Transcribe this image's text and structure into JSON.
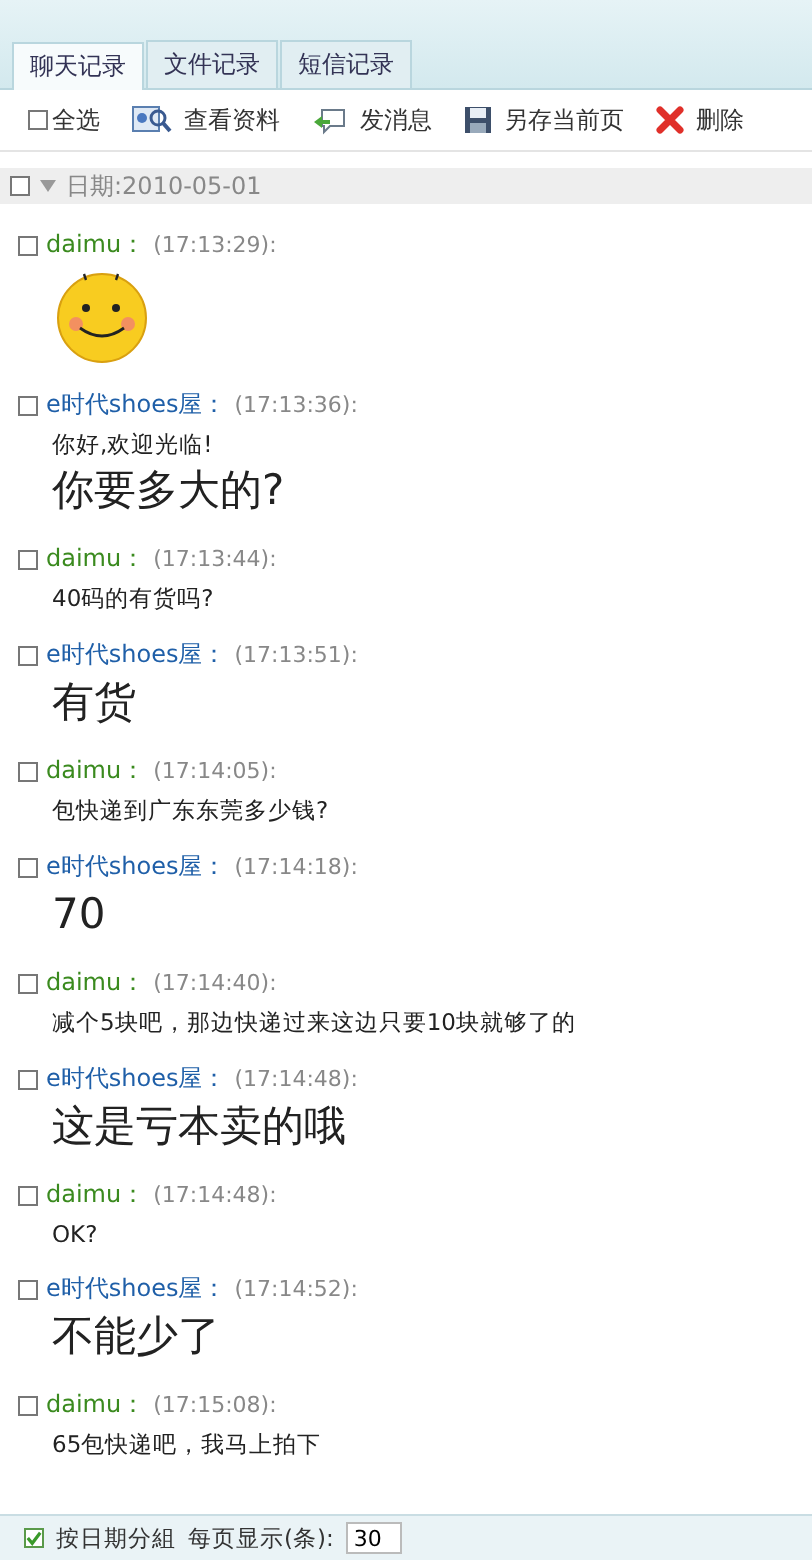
{
  "tabs": [
    {
      "label": "聊天记录",
      "selected": true
    },
    {
      "label": "文件记录",
      "selected": false
    },
    {
      "label": "短信记录",
      "selected": false
    }
  ],
  "toolbar": {
    "select_all": {
      "label": "全选",
      "checked": false
    },
    "actions": [
      {
        "kind": "profile",
        "label": "查看资料"
      },
      {
        "kind": "message",
        "label": "发消息"
      },
      {
        "kind": "save",
        "label": "另存当前页"
      },
      {
        "kind": "delete",
        "label": "删除"
      }
    ]
  },
  "date_group": {
    "label": "日期:2010-05-01",
    "checked": false,
    "expanded": true
  },
  "messages": [
    {
      "sender": "daimu：",
      "color": "#3a8a1e",
      "time": "(17:13:29):",
      "checked": false,
      "kind": "emoticon"
    },
    {
      "sender": "e时代shoes屋：",
      "color": "#1f5fa8",
      "time": "(17:13:36):",
      "checked": false,
      "kind": "mixed",
      "lines": [
        {
          "kind": "small",
          "text": "你好,欢迎光临!"
        },
        {
          "kind": "large",
          "text": "你要多大的?"
        }
      ]
    },
    {
      "sender": "daimu：",
      "color": "#3a8a1e",
      "time": "(17:13:44):",
      "checked": false,
      "kind": "text",
      "lines": [
        {
          "kind": "small",
          "text": "40码的有货吗?"
        }
      ]
    },
    {
      "sender": "e时代shoes屋：",
      "color": "#1f5fa8",
      "time": "(17:13:51):",
      "checked": false,
      "kind": "text",
      "lines": [
        {
          "kind": "large",
          "text": "有货"
        }
      ]
    },
    {
      "sender": "daimu：",
      "color": "#3a8a1e",
      "time": "(17:14:05):",
      "checked": false,
      "kind": "text",
      "lines": [
        {
          "kind": "small",
          "text": "包快递到广东东莞多少钱?"
        }
      ]
    },
    {
      "sender": "e时代shoes屋：",
      "color": "#1f5fa8",
      "time": "(17:14:18):",
      "checked": false,
      "kind": "text",
      "lines": [
        {
          "kind": "large",
          "text": "70"
        }
      ]
    },
    {
      "sender": "daimu：",
      "color": "#3a8a1e",
      "time": "(17:14:40):",
      "checked": false,
      "kind": "text",
      "lines": [
        {
          "kind": "small",
          "text": "减个5块吧，那边快递过来这边只要10块就够了的"
        }
      ]
    },
    {
      "sender": "e时代shoes屋：",
      "color": "#1f5fa8",
      "time": "(17:14:48):",
      "checked": false,
      "kind": "text",
      "lines": [
        {
          "kind": "large",
          "text": "这是亏本卖的哦"
        }
      ]
    },
    {
      "sender": "daimu：",
      "color": "#3a8a1e",
      "time": "(17:14:48):",
      "checked": false,
      "kind": "text",
      "lines": [
        {
          "kind": "small",
          "text": "OK?"
        }
      ]
    },
    {
      "sender": "e时代shoes屋：",
      "color": "#1f5fa8",
      "time": "(17:14:52):",
      "checked": false,
      "kind": "text",
      "lines": [
        {
          "kind": "large",
          "text": "不能少了"
        }
      ]
    },
    {
      "sender": "daimu：",
      "color": "#3a8a1e",
      "time": "(17:15:08):",
      "checked": false,
      "kind": "text",
      "lines": [
        {
          "kind": "small",
          "text": "65包快递吧，我马上拍下"
        }
      ]
    }
  ],
  "footer": {
    "group_by_date": {
      "label": "按日期分組",
      "checked": true
    },
    "page_size_label": "每页显示(条):",
    "page_size": "30"
  }
}
